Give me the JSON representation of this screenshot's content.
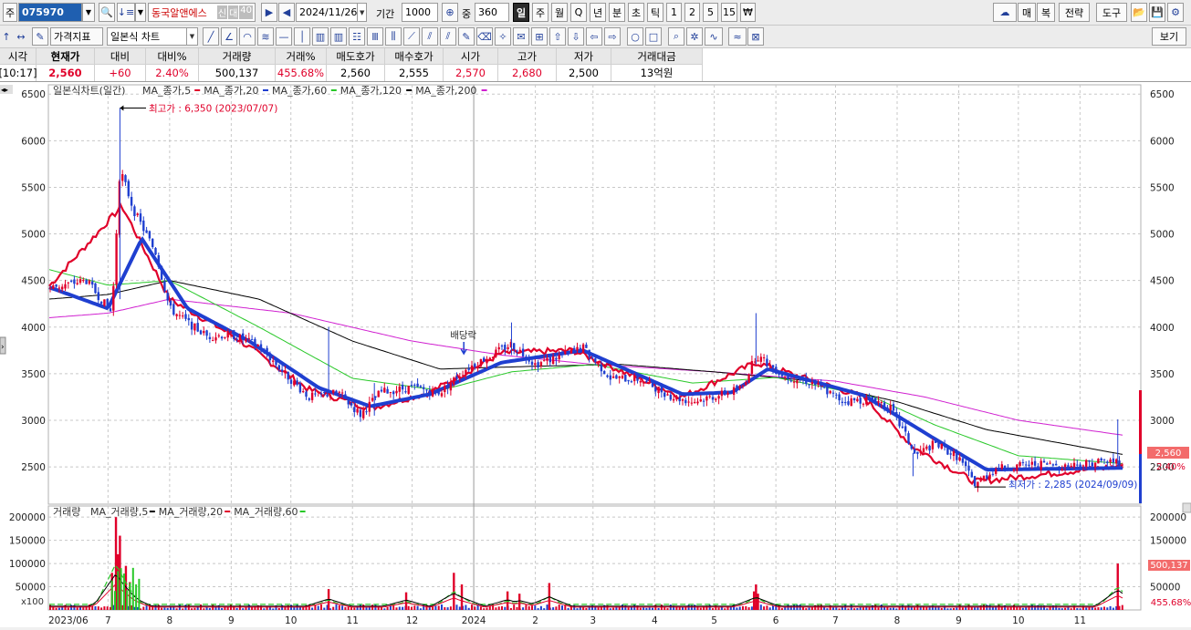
{
  "toolbar": {
    "market_label": "주",
    "stock_code": "075970",
    "stock_name": "동국알앤에스",
    "badge_credit": "신",
    "badge_margin": "대",
    "badge_rate": "40",
    "date": "2024/11/26",
    "period_label": "기간",
    "period_value": "1000",
    "overlap_label": "중",
    "overlap_value": "360",
    "periods": [
      "일",
      "주",
      "월",
      "Q",
      "년",
      "분",
      "초",
      "틱",
      "1",
      "2",
      "5",
      "15",
      "₩"
    ],
    "active_period": "일",
    "right_menus": [
      "매",
      "복",
      "전략",
      "도구"
    ],
    "indicator_select": "가격지표",
    "chart_type_select": "일본식 차트",
    "view_button": "보기"
  },
  "quote": {
    "headers": [
      "시각",
      "현재가",
      "대비",
      "대비%",
      "거래량",
      "거래%",
      "매도호가",
      "매수호가",
      "시가",
      "고가",
      "저가",
      "거래대금"
    ],
    "values": [
      "[10:17]",
      "2,560",
      "+60",
      "2.40%",
      "500,137",
      "455.68%",
      "2,560",
      "2,555",
      "2,570",
      "2,680",
      "2,500",
      "13억원"
    ]
  },
  "price_panel": {
    "title": "일본식차트(일간)",
    "legend": [
      "MA_종가,5",
      "MA_종가,20",
      "MA_종가,60",
      "MA_종가,120",
      "MA_종가,200"
    ],
    "high_note": "최고가 : 6,350 (2023/07/07)",
    "low_note": "최저가 : 2,285 (2024/09/09)",
    "event_note": "배당락",
    "current_price_tag": "2,560",
    "current_change_tag": "2.40%",
    "y_ticks": [
      "6500",
      "6000",
      "5500",
      "5000",
      "4500",
      "4000",
      "3500",
      "3000",
      "2500"
    ]
  },
  "volume_panel": {
    "title": "거래량",
    "legend": [
      "MA_거래량,5",
      "MA_거래량,20",
      "MA_거래량,60"
    ],
    "unit_label": "x100",
    "volume_tag": "500,137",
    "ratio_tag": "455.68%",
    "y_ticks": [
      "200000",
      "150000",
      "100000",
      "50000"
    ]
  },
  "x_axis": [
    "2023/06",
    "7",
    "8",
    "9",
    "10",
    "11",
    "12",
    "2024",
    "2",
    "3",
    "4",
    "5",
    "6",
    "7",
    "8",
    "9",
    "10",
    "11"
  ],
  "colors": {
    "up": "#e0002a",
    "down": "#1f3fd0",
    "ma5": "#e0002a",
    "ma20": "#1f3fd0",
    "ma60": "#28c828",
    "ma120": "#000000",
    "ma200": "#d020d0"
  },
  "chart_data": {
    "type": "candlestick",
    "x_range": [
      "2023/06",
      "2024/11/26"
    ],
    "ylim": [
      2100,
      6600
    ],
    "price_anchors": [
      [
        "2023/06/01",
        4420
      ],
      [
        "2023/06/20",
        4500
      ],
      [
        "2023/07/03",
        4150
      ],
      [
        "2023/07/07",
        5700
      ],
      [
        "2023/07/14",
        5250
      ],
      [
        "2023/07/25",
        4800
      ],
      [
        "2023/08/01",
        4200
      ],
      [
        "2023/08/10",
        4050
      ],
      [
        "2023/08/20",
        3900
      ],
      [
        "2023/09/01",
        3920
      ],
      [
        "2023/09/15",
        3800
      ],
      [
        "2023/09/28",
        3500
      ],
      [
        "2023/10/10",
        3250
      ],
      [
        "2023/10/25",
        3300
      ],
      [
        "2023/11/05",
        3060
      ],
      [
        "2023/11/15",
        3300
      ],
      [
        "2023/11/30",
        3350
      ],
      [
        "2023/12/15",
        3300
      ],
      [
        "2023/12/28",
        3550
      ],
      [
        "2024/01/10",
        3700
      ],
      [
        "2024/01/20",
        3820
      ],
      [
        "2024/02/01",
        3600
      ],
      [
        "2024/02/15",
        3700
      ],
      [
        "2024/02/25",
        3780
      ],
      [
        "2024/03/10",
        3450
      ],
      [
        "2024/03/25",
        3440
      ],
      [
        "2024/04/10",
        3250
      ],
      [
        "2024/04/20",
        3200
      ],
      [
        "2024/05/05",
        3280
      ],
      [
        "2024/05/15",
        3350
      ],
      [
        "2024/05/22",
        3700
      ],
      [
        "2024/06/05",
        3480
      ],
      [
        "2024/06/20",
        3400
      ],
      [
        "2024/07/05",
        3200
      ],
      [
        "2024/07/20",
        3230
      ],
      [
        "2024/07/28",
        3150
      ],
      [
        "2024/08/05",
        2850
      ],
      [
        "2024/08/10",
        2620
      ],
      [
        "2024/08/20",
        2750
      ],
      [
        "2024/09/01",
        2600
      ],
      [
        "2024/09/09",
        2320
      ],
      [
        "2024/09/20",
        2480
      ],
      [
        "2024/10/10",
        2530
      ],
      [
        "2024/10/25",
        2510
      ],
      [
        "2024/11/10",
        2560
      ],
      [
        "2024/11/26",
        2560
      ]
    ],
    "ma_anchors": {
      "MA_종가,5": [
        [
          "2023/06/01",
          4430
        ],
        [
          "2023/07/08",
          5300
        ],
        [
          "2023/08/01",
          4300
        ],
        [
          "2023/09/01",
          3920
        ],
        [
          "2023/10/10",
          3330
        ],
        [
          "2023/11/10",
          3130
        ],
        [
          "2023/12/10",
          3300
        ],
        [
          "2024/01/15",
          3720
        ],
        [
          "2024/02/20",
          3750
        ],
        [
          "2024/04/15",
          3250
        ],
        [
          "2024/05/22",
          3620
        ],
        [
          "2024/07/15",
          3250
        ],
        [
          "2024/08/10",
          2700
        ],
        [
          "2024/09/09",
          2340
        ],
        [
          "2024/11/26",
          2520
        ]
      ],
      "MA_종가,20": [
        [
          "2023/06/01",
          4430
        ],
        [
          "2023/07/01",
          4200
        ],
        [
          "2023/07/18",
          4950
        ],
        [
          "2023/08/10",
          4200
        ],
        [
          "2023/09/10",
          3850
        ],
        [
          "2023/10/15",
          3350
        ],
        [
          "2023/11/10",
          3150
        ],
        [
          "2023/12/10",
          3280
        ],
        [
          "2024/01/15",
          3620
        ],
        [
          "2024/02/25",
          3750
        ],
        [
          "2024/04/15",
          3280
        ],
        [
          "2024/05/10",
          3300
        ],
        [
          "2024/05/28",
          3550
        ],
        [
          "2024/07/15",
          3270
        ],
        [
          "2024/08/20",
          2800
        ],
        [
          "2024/09/15",
          2470
        ],
        [
          "2024/11/26",
          2490
        ]
      ],
      "MA_종가,60": [
        [
          "2023/06/01",
          4620
        ],
        [
          "2023/07/01",
          4450
        ],
        [
          "2023/08/01",
          4500
        ],
        [
          "2023/09/15",
          4000
        ],
        [
          "2023/11/01",
          3450
        ],
        [
          "2023/12/15",
          3320
        ],
        [
          "2024/01/20",
          3520
        ],
        [
          "2024/03/01",
          3600
        ],
        [
          "2024/04/20",
          3400
        ],
        [
          "2024/06/01",
          3460
        ],
        [
          "2024/07/20",
          3250
        ],
        [
          "2024/08/20",
          2950
        ],
        [
          "2024/10/01",
          2620
        ],
        [
          "2024/11/26",
          2530
        ]
      ],
      "MA_종가,120": [
        [
          "2023/06/01",
          4300
        ],
        [
          "2023/07/01",
          4350
        ],
        [
          "2023/08/01",
          4500
        ],
        [
          "2023/09/15",
          4300
        ],
        [
          "2023/11/01",
          3850
        ],
        [
          "2023/12/15",
          3550
        ],
        [
          "2024/02/01",
          3580
        ],
        [
          "2024/03/15",
          3600
        ],
        [
          "2024/05/01",
          3520
        ],
        [
          "2024/06/15",
          3430
        ],
        [
          "2024/08/01",
          3200
        ],
        [
          "2024/09/15",
          2900
        ],
        [
          "2024/11/26",
          2620
        ]
      ],
      "MA_종가,200": [
        [
          "2023/06/01",
          4100
        ],
        [
          "2023/07/01",
          4150
        ],
        [
          "2023/08/01",
          4300
        ],
        [
          "2023/10/01",
          4150
        ],
        [
          "2023/12/01",
          3850
        ],
        [
          "2024/01/15",
          3700
        ],
        [
          "2024/03/01",
          3600
        ],
        [
          "2024/05/01",
          3520
        ],
        [
          "2024/07/01",
          3420
        ],
        [
          "2024/08/15",
          3250
        ],
        [
          "2024/10/01",
          3000
        ],
        [
          "2024/11/26",
          2830
        ]
      ]
    },
    "volume_spikes": [
      [
        "2023/07/03",
        80000
      ],
      [
        "2023/07/05",
        200000
      ],
      [
        "2023/07/06",
        120000
      ],
      [
        "2023/07/07",
        160000
      ],
      [
        "2023/07/10",
        95000
      ],
      [
        "2023/07/12",
        60000
      ],
      [
        "2023/10/20",
        45000
      ],
      [
        "2023/11/28",
        38000
      ],
      [
        "2023/12/22",
        80000
      ],
      [
        "2023/12/26",
        55000
      ],
      [
        "2024/01/18",
        40000
      ],
      [
        "2024/01/24",
        35000
      ],
      [
        "2024/02/08",
        58000
      ],
      [
        "2024/05/21",
        40000
      ],
      [
        "2024/05/22",
        55000
      ],
      [
        "2024/05/23",
        35000
      ],
      [
        "2024/11/20",
        100000
      ]
    ],
    "volume_ylim": [
      0,
      220000
    ]
  }
}
